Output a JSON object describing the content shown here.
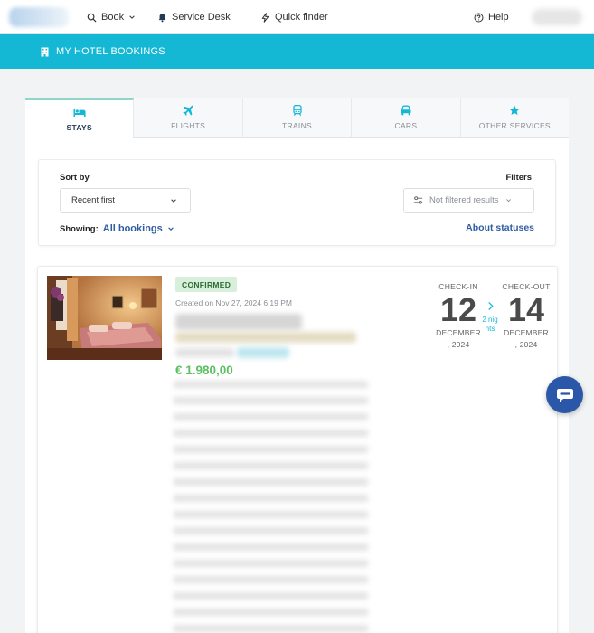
{
  "nav": {
    "book": "Book",
    "service_desk": "Service Desk",
    "quick_finder": "Quick finder",
    "help": "Help"
  },
  "banner": {
    "title": "MY HOTEL BOOKINGS"
  },
  "tabs": [
    {
      "label": "STAYS",
      "icon": "bed-icon",
      "active": true
    },
    {
      "label": "FLIGHTS",
      "icon": "plane-icon",
      "active": false
    },
    {
      "label": "TRAINS",
      "icon": "train-icon",
      "active": false
    },
    {
      "label": "CARS",
      "icon": "car-icon",
      "active": false
    },
    {
      "label": "OTHER SERVICES",
      "icon": "star-icon",
      "active": false
    }
  ],
  "filters": {
    "sort_label": "Sort by",
    "sort_value": "Recent first",
    "filters_label": "Filters",
    "filter_value": "Not filtered results",
    "showing_label": "Showing:",
    "showing_value": "All bookings",
    "about_statuses": "About statuses"
  },
  "booking": {
    "status": "CONFIRMED",
    "created": "Created on Nov 27, 2024 6:19 PM",
    "price": "€ 1.980,00",
    "checkin_label": "CHECK-IN",
    "checkin_day": "12",
    "checkin_month": "DECEMBER",
    "checkin_year": ", 2024",
    "checkout_label": "CHECK-OUT",
    "checkout_day": "14",
    "checkout_month": "DECEMBER",
    "checkout_year": ", 2024",
    "nights": "2 nights"
  },
  "colors": {
    "banner": "#14b8d4",
    "link": "#2f5ea0",
    "price": "#5cbf62",
    "chat": "#2a57a8"
  }
}
